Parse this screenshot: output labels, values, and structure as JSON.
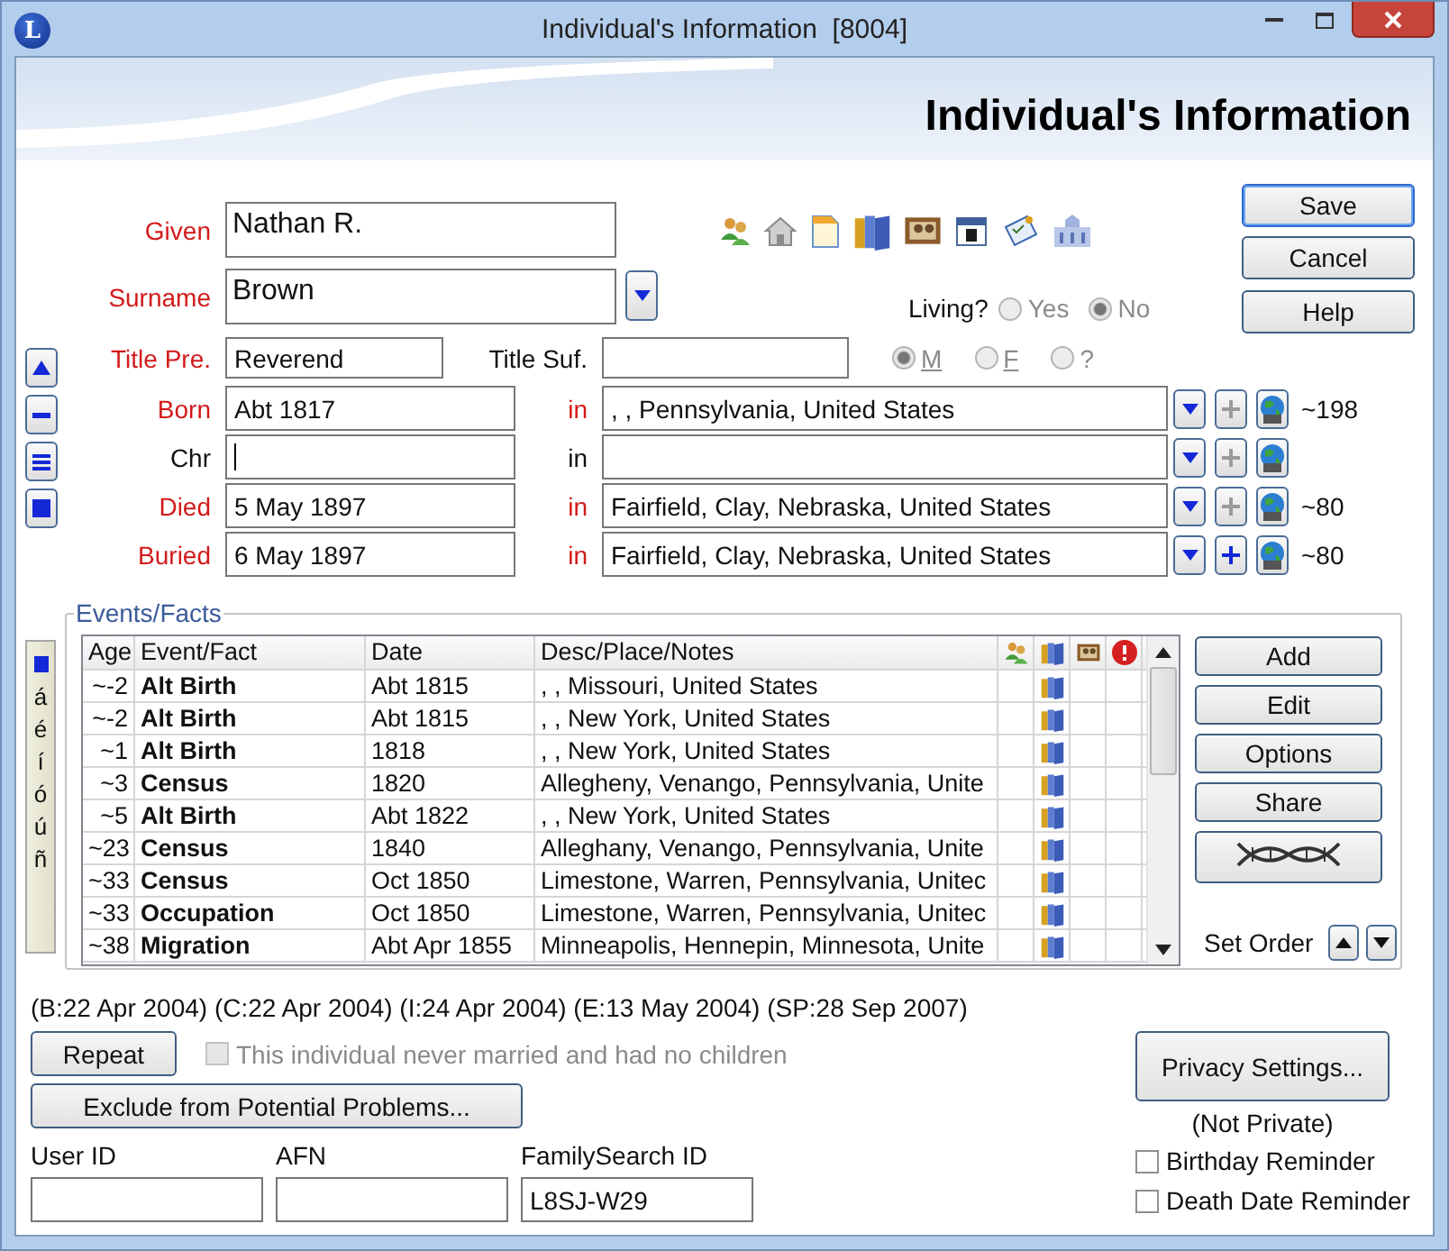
{
  "window": {
    "app_icon_letter": "L",
    "title": "Individual's Information  [8004]"
  },
  "heading": "Individual's Information",
  "name_fields": [
    {
      "label": "Given",
      "value": "Nathan R.",
      "highlighted": true,
      "kind": "plain"
    },
    {
      "label": "Surname",
      "value": "Brown",
      "highlighted": true,
      "kind": "dropdown"
    }
  ],
  "dialog_buttons": [
    {
      "label": "Save",
      "default": true
    },
    {
      "label": "Cancel",
      "default": false
    },
    {
      "label": "Help",
      "default": false
    }
  ],
  "living": {
    "label": "Living?",
    "options": [
      {
        "label": "Yes",
        "selected": false
      },
      {
        "label": "No",
        "selected": true
      }
    ]
  },
  "title_prefix": {
    "label": "Title Pre.",
    "value": "Reverend",
    "highlighted": true
  },
  "title_suffix": {
    "label": "Title Suf.",
    "highlighted": false
  },
  "sex": [
    {
      "label": "M",
      "selected": true
    },
    {
      "label": "F",
      "selected": false
    },
    {
      "label": "?",
      "selected": false
    }
  ],
  "vital_events": [
    {
      "label": "Born",
      "date": "Abt 1817",
      "in_label": "in",
      "place": ", , Pennsylvania, United States",
      "highlighted": true,
      "focused": false,
      "plus_active": false,
      "age": "~198"
    },
    {
      "label": "Chr",
      "in_label": "in",
      "highlighted": false,
      "focused": true,
      "plus_active": false
    },
    {
      "label": "Died",
      "date": "5 May 1897",
      "in_label": "in",
      "place": "Fairfield, Clay, Nebraska, United States",
      "highlighted": true,
      "focused": false,
      "plus_active": false,
      "age": "~80"
    },
    {
      "label": "Buried",
      "date": "6 May 1897",
      "in_label": "in",
      "place": "Fairfield, Clay, Nebraska, United States",
      "highlighted": true,
      "focused": false,
      "plus_active": true,
      "age": "~80"
    }
  ],
  "events": {
    "legend": "Events/Facts",
    "accent_chars": [
      "á",
      "é",
      "í",
      "ó",
      "ú",
      "ñ"
    ],
    "columns": [
      "Age",
      "Event/Fact",
      "Date",
      "Desc/Place/Notes"
    ],
    "rows": [
      {
        "age": "~-2",
        "event": "Alt Birth",
        "date": "Abt 1815",
        "place": ", , Missouri, United States",
        "has_source": true
      },
      {
        "age": "~-2",
        "event": "Alt Birth",
        "date": "Abt 1815",
        "place": ", , New York, United States",
        "has_source": true
      },
      {
        "age": "~1",
        "event": "Alt Birth",
        "date": "1818",
        "place": ", , New York, United States",
        "has_source": true
      },
      {
        "age": "~3",
        "event": "Census",
        "date": "1820",
        "place": "Allegheny, Venango, Pennsylvania, Unite",
        "has_source": true
      },
      {
        "age": "~5",
        "event": "Alt Birth",
        "date": "Abt 1822",
        "place": ", , New York, United States",
        "has_source": true
      },
      {
        "age": "~23",
        "event": "Census",
        "date": "1840",
        "place": "Alleghany, Venango, Pennsylvania, Unite",
        "has_source": true
      },
      {
        "age": "~33",
        "event": "Census",
        "date": "Oct 1850",
        "place": "Limestone, Warren, Pennsylvania, Unitec",
        "has_source": true
      },
      {
        "age": "~33",
        "event": "Occupation",
        "date": "Oct 1850",
        "place": "Limestone, Warren, Pennsylvania, Unitec",
        "has_source": true
      },
      {
        "age": "~38",
        "event": "Migration",
        "date": "Abt Apr 1855",
        "place": "Minneapolis, Hennepin, Minnesota, Unite",
        "has_source": true
      }
    ],
    "buttons": [
      "Add",
      "Edit",
      "Options",
      "Share"
    ],
    "set_order_label": "Set Order"
  },
  "change_dates": "(B:22 Apr 2004) (C:22 Apr 2004) (I:24 Apr 2004) (E:13 May 2004) (SP:28 Sep 2007)",
  "repeat_button": "Repeat",
  "never_married": {
    "label": "This individual never married and had no children",
    "checked": false,
    "disabled": true
  },
  "exclude_button": "Exclude from Potential Problems...",
  "id_fields": [
    {
      "label": "User ID"
    },
    {
      "label": "AFN"
    },
    {
      "label": "FamilySearch ID",
      "value": "L8SJ-W29"
    }
  ],
  "privacy": {
    "button": "Privacy Settings...",
    "status": "(Not Private)"
  },
  "reminders": [
    {
      "label": "Birthday Reminder",
      "checked": false
    },
    {
      "label": "Death Date Reminder",
      "checked": false
    }
  ]
}
